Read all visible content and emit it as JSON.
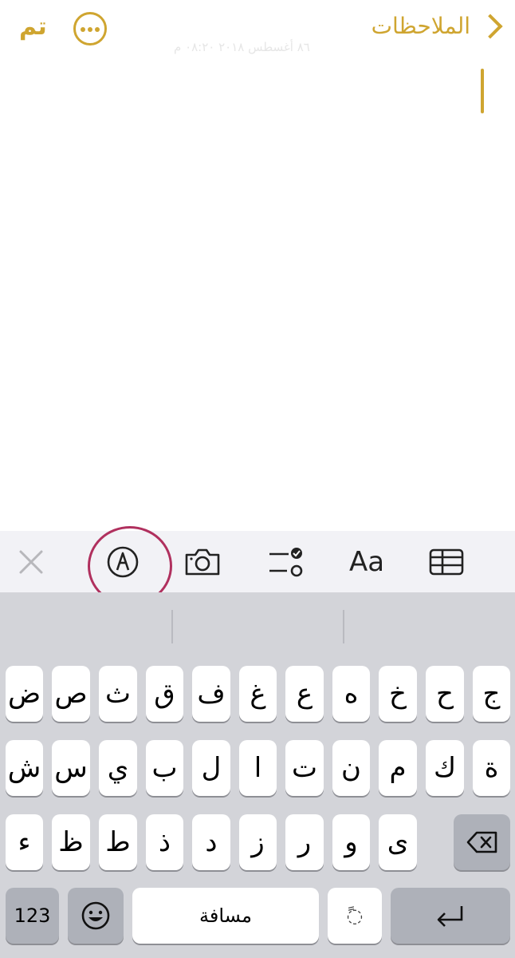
{
  "nav": {
    "done_label": "تم",
    "back_label": "الملاحظات",
    "more_icon": "ellipsis-circle-icon"
  },
  "note": {
    "faint_text": "٨٦ أغسطس ٢٠١٨ ٠٨:٢٠ م"
  },
  "toolbar": {
    "items": [
      "close-icon",
      "markup-pen-icon",
      "camera-icon",
      "checklist-icon",
      "text-format-icon",
      "table-icon"
    ],
    "format_label": "Aa"
  },
  "keyboard": {
    "row1": [
      "ض",
      "ص",
      "ث",
      "ق",
      "ف",
      "غ",
      "ع",
      "ه",
      "خ",
      "ح",
      "ج"
    ],
    "row2": [
      "ش",
      "س",
      "ي",
      "ب",
      "ل",
      "ا",
      "ت",
      "ن",
      "م",
      "ك",
      "ة"
    ],
    "row3": [
      "ء",
      "ظ",
      "ط",
      "ذ",
      "د",
      "ز",
      "ر",
      "و",
      "ى"
    ],
    "numbers_label": "123",
    "space_label": "مسافة",
    "diacritic_label": "ً◌"
  }
}
